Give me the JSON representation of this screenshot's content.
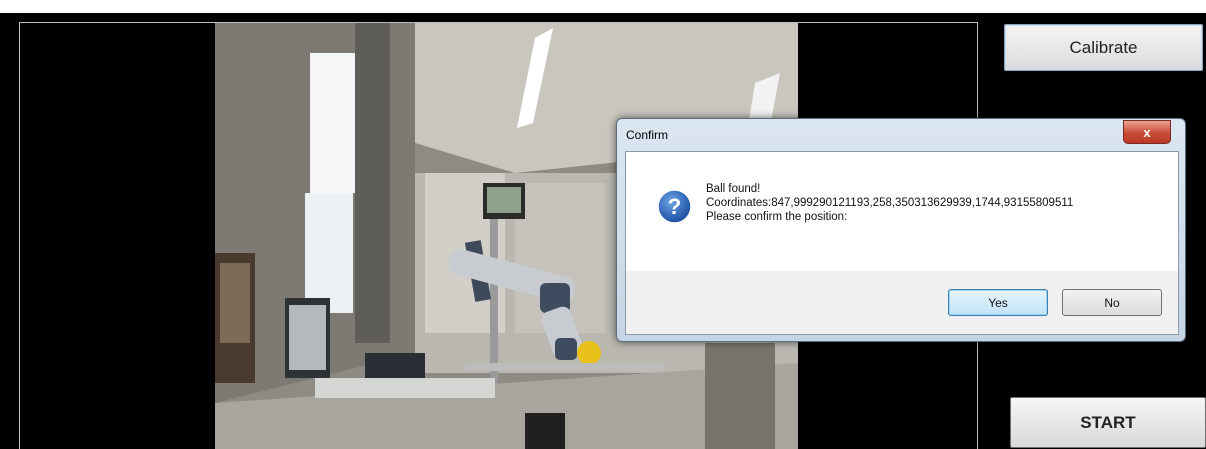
{
  "buttons": {
    "calibrate_label": "Calibrate",
    "start_label": "START"
  },
  "dialog": {
    "title": "Confirm",
    "close_glyph": "x",
    "icon": "question-icon",
    "message_lines": [
      "Ball found!",
      "Coordinates:847,999290121193,258,350313629939,1744,93155809511",
      "Please confirm the position:"
    ],
    "yes_label": "Yes",
    "no_label": "No"
  },
  "colors": {
    "background": "#000000",
    "dialog_frame": "#c6d5e4",
    "close_button": "#c94b35",
    "default_button_border": "#3c7fb1"
  }
}
